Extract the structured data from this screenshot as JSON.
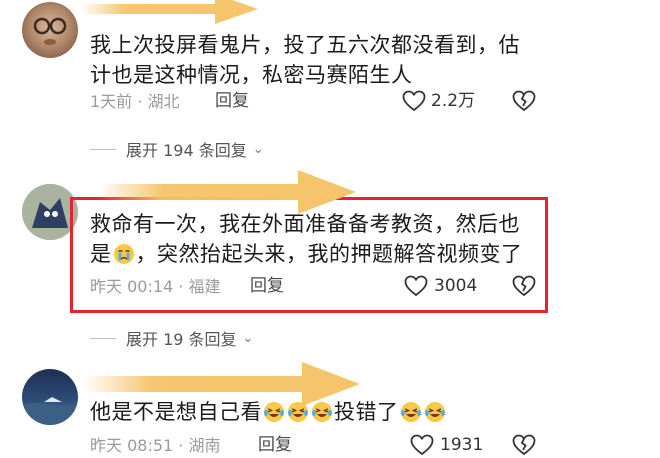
{
  "comments": [
    {
      "text_lines": [
        "我上次投屏看鬼片，投了五六次都没看到，估",
        "计也是这种情况，私密马赛陌生人"
      ],
      "time": "1天前",
      "location": "湖北",
      "reply_label": "回复",
      "likes": "2.2万",
      "expand_label": "展开 194 条回复"
    },
    {
      "text_line1": "救命有一次，我在外面准备备考教资，然后也",
      "text_line2_prefix": "是",
      "text_line2_suffix": "，突然抬起头来，我的押题解答视频变了",
      "time": "昨天 00:14",
      "location": "福建",
      "reply_label": "回复",
      "likes": "3004",
      "expand_label": "展开 19 条回复"
    },
    {
      "text_prefix": "他是不是想自己看",
      "text_mid": "投错了",
      "time": "昨天 08:51",
      "location": "湖南",
      "reply_label": "回复",
      "likes": "1931"
    }
  ],
  "icons": [
    "heart-outline-icon",
    "broken-heart-icon",
    "crying-emoji-icon",
    "laughing-crying-emoji-icon",
    "chevron-down-icon"
  ],
  "colors": {
    "highlight_border": "#e8232d",
    "arrow": "#f5c46a",
    "meta": "#9a9a9a"
  }
}
